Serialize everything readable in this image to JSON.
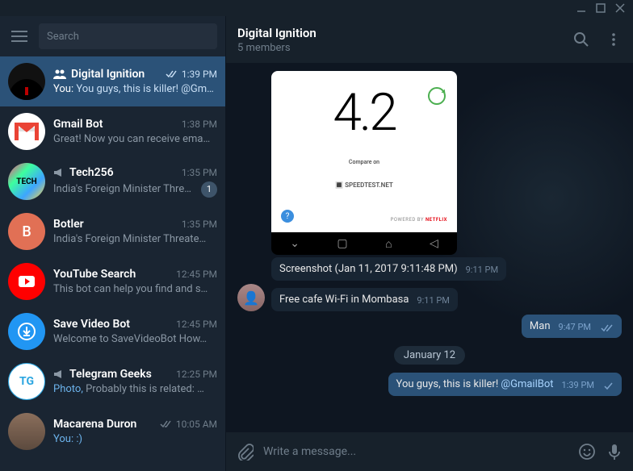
{
  "titlebar": {},
  "sidebar": {
    "search_placeholder": "Search",
    "chats": [
      {
        "name": "Digital Ignition",
        "time": "1:39 PM",
        "preview_prefix": "You: ",
        "preview": "You guys, this is killer! @Gm…",
        "group": true,
        "checked": true
      },
      {
        "name": "Gmail Bot",
        "time": "1:38 PM",
        "preview": "Great! Now you can receive ema…"
      },
      {
        "name": "Tech256",
        "time": "1:35 PM",
        "preview": "India's Foreign Minister Thre…",
        "channel": true,
        "badge": "1"
      },
      {
        "name": "Botler",
        "time": "1:35 PM",
        "preview": "India's Foreign Minister Threate…"
      },
      {
        "name": "YouTube Search",
        "time": "12:45 PM",
        "preview": "This bot can help you find and s…"
      },
      {
        "name": "Save Video Bot",
        "time": "12:45 PM",
        "preview": "Welcome to SaveVideoBot  How…"
      },
      {
        "name": "Telegram Geeks",
        "time": "12:25 PM",
        "preview_link": "Photo, ",
        "preview": "Probably this is related:  …",
        "channel": true
      },
      {
        "name": "Macarena Duron",
        "time": "10:05 AM",
        "preview_prefix": "You: ",
        "preview": ":)",
        "checked": true
      }
    ]
  },
  "header": {
    "name": "Digital Ignition",
    "subtitle": "5 members"
  },
  "messages": {
    "speedtest_value": "4.2",
    "speedtest_compare": "Compare on",
    "speedtest_site": "🔳 SPEEDTEST.NET",
    "speedtest_powered": "POWERED BY ",
    "speedtest_brand": "NETFLIX",
    "m1_text": "Screenshot (Jan 11, 2017 9:11:48 PM)",
    "m1_time": "9:11 PM",
    "m2_text": "Free cafe Wi-Fi in Mombasa",
    "m2_time": "9:11 PM",
    "m3_text": "Man",
    "m3_time": "9:47 PM",
    "date_sep": "January 12",
    "m4_text": "You guys, this is killer! ",
    "m4_mention": "@GmailBot",
    "m4_time": "1:39 PM"
  },
  "composer": {
    "placeholder": "Write a message..."
  }
}
